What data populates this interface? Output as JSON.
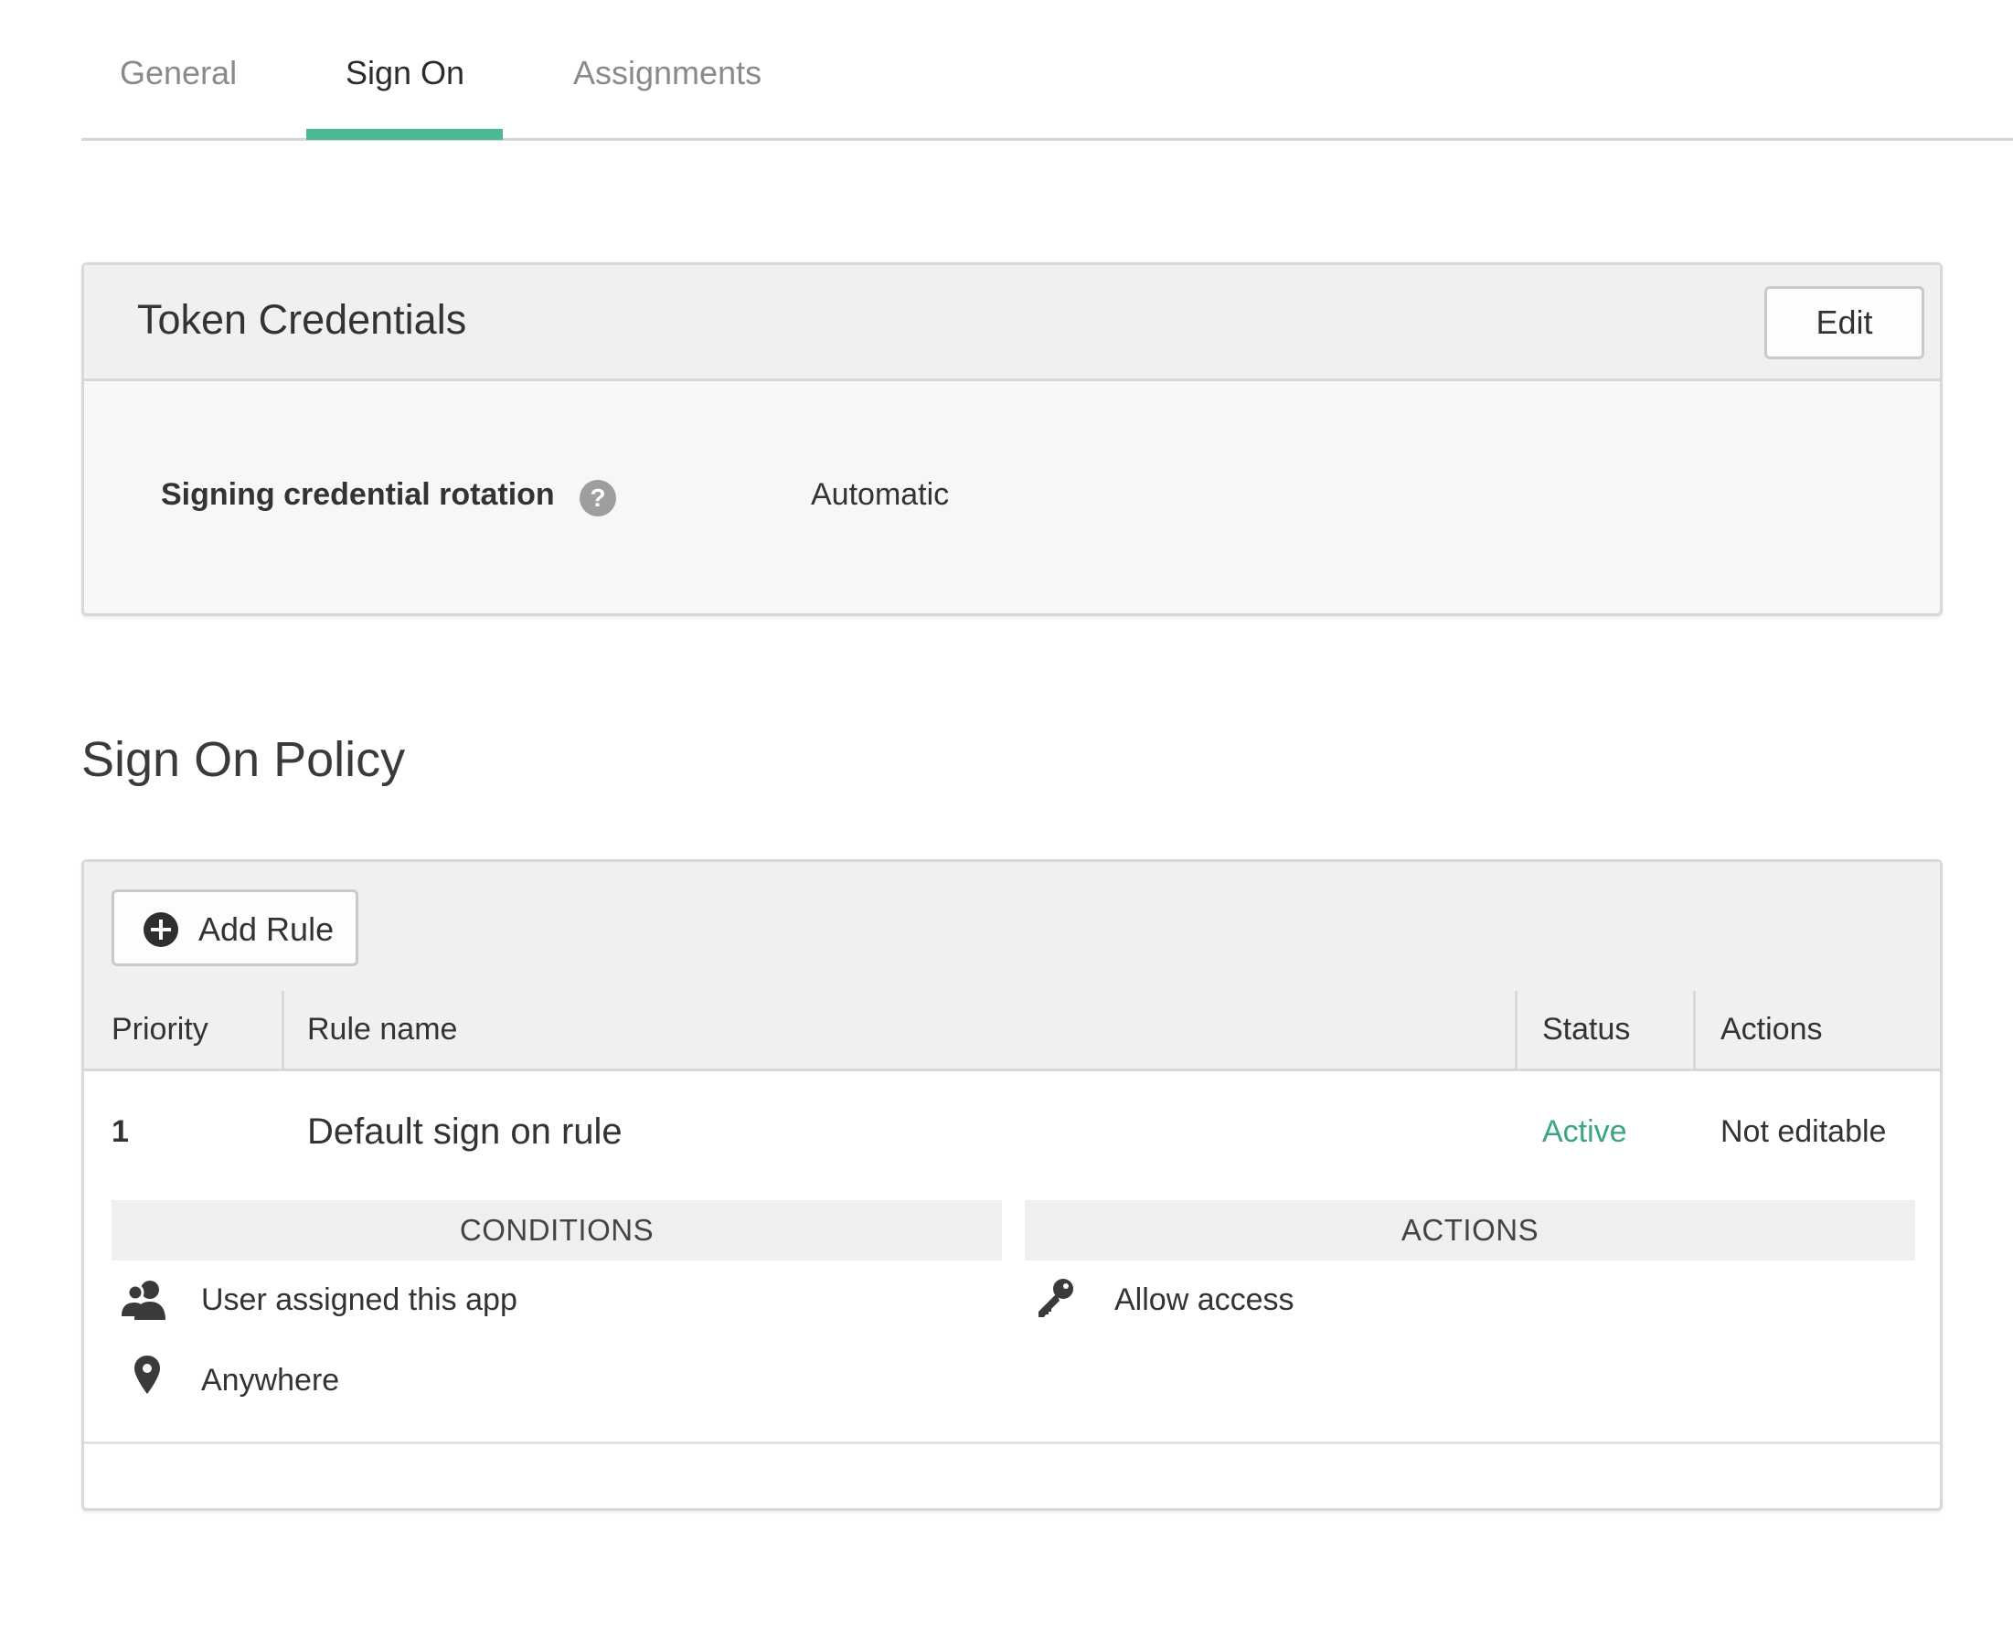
{
  "tabs": [
    {
      "label": "General",
      "active": false
    },
    {
      "label": "Sign On",
      "active": true
    },
    {
      "label": "Assignments",
      "active": false
    }
  ],
  "accent_color": "#4cb894",
  "token_credentials": {
    "title": "Token Credentials",
    "edit_label": "Edit",
    "field_label": "Signing credential rotation",
    "help_glyph": "?",
    "field_value": "Automatic"
  },
  "policy": {
    "title": "Sign On Policy",
    "add_rule_label": "Add Rule",
    "columns": [
      "Priority",
      "Rule name",
      "Status",
      "Actions"
    ],
    "rule": {
      "priority": "1",
      "name": "Default sign on rule",
      "status": "Active",
      "status_color": "#3aa57f",
      "actions": "Not editable"
    },
    "conditions_heading": "CONDITIONS",
    "actions_heading": "ACTIONS",
    "conditions": [
      {
        "icon": "user-icon",
        "text": "User assigned this app"
      },
      {
        "icon": "location-pin-icon",
        "text": "Anywhere"
      }
    ],
    "actions": [
      {
        "icon": "key-icon",
        "text": "Allow access"
      }
    ]
  }
}
